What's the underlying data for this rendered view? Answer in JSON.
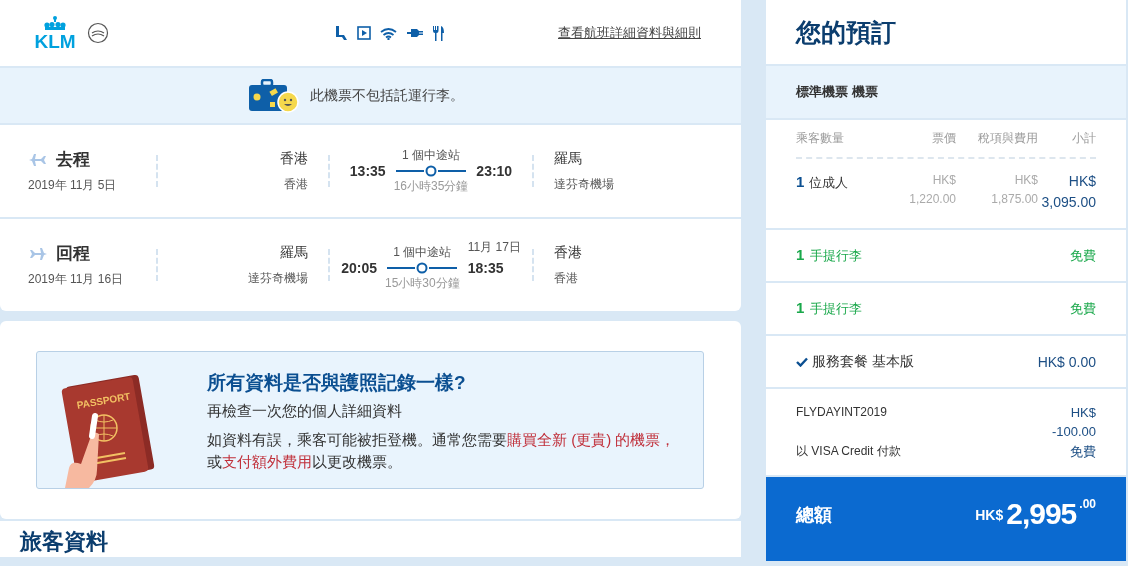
{
  "header": {
    "logo": "KLM",
    "details_link": "查看航班詳細資料與細則"
  },
  "baggage_notice": "此機票不包括託運行李。",
  "flights": [
    {
      "direction": "去程",
      "date": "2019年 11月 5日",
      "origin_city": "香港",
      "origin_airport": "香港",
      "depart": "13:35",
      "stops": "1 個中途站",
      "duration": "16小時35分鐘",
      "arrive": "23:10",
      "dest_city": "羅馬",
      "dest_airport": "達芬奇機場"
    },
    {
      "direction": "回程",
      "date": "2019年 11月 16日",
      "origin_city": "羅馬",
      "origin_airport": "達芬奇機場",
      "depart": "20:05",
      "stops": "1 個中途站",
      "duration": "15小時30分鐘",
      "arrive_date": "11月 17日",
      "arrive": "18:35",
      "dest_city": "香港",
      "dest_airport": "香港"
    }
  ],
  "passport_notice": {
    "illustration_label": "PASSPORT",
    "title": "所有資料是否與護照記錄一樣?",
    "subtitle": "再檢查一次您的個人詳細資料",
    "body": [
      {
        "kind": "text",
        "text": "如資料有誤，乘客可能被拒登機。通常您需要"
      },
      {
        "kind": "link",
        "text": "購買全新 (更貴) 的機票，"
      },
      {
        "kind": "text",
        "text": "或"
      },
      {
        "kind": "link",
        "text": "支付額外費用"
      },
      {
        "kind": "text",
        "text": "以更改機票。"
      }
    ]
  },
  "passenger_section": {
    "title": "旅客資料"
  },
  "summary": {
    "title": "您的預訂",
    "fare_name": "標準機票 機票",
    "columns": [
      "乘客數量",
      "票價",
      "稅項與費用",
      "小計"
    ],
    "passenger_row": {
      "count": "1",
      "label": "位成人",
      "fare": [
        "HK$",
        "1,220.00"
      ],
      "taxes": [
        "HK$",
        "1,875.00"
      ],
      "subtotal": [
        "HK$",
        "3,095.00"
      ]
    },
    "baggage": [
      {
        "count": "1",
        "label": "手提行李",
        "price": "免費"
      },
      {
        "count": "1",
        "label": "手提行李",
        "price": "免費"
      }
    ],
    "service": {
      "checked": true,
      "label": "服務套餐 基本版",
      "price": "HK$ 0.00"
    },
    "promo": {
      "code": "FLYDAYINT2019",
      "currency": "HK$",
      "amount": "-100.00"
    },
    "payment": {
      "label": "以 VISA Credit 付款",
      "price": "免費"
    },
    "total": {
      "label": "總額",
      "currency": "HK$",
      "amount": "2,995",
      "cents": ".00"
    }
  }
}
